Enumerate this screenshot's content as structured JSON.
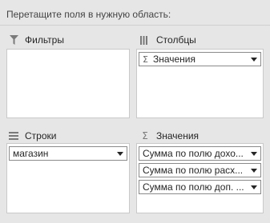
{
  "instruction": "Перетащите поля в нужную область:",
  "areas": {
    "filters": {
      "title": "Фильтры",
      "icon": "filter-icon",
      "fields": []
    },
    "columns": {
      "title": "Столбцы",
      "icon": "columns-icon",
      "fields": [
        {
          "label": "Значения",
          "icon": "sigma-icon"
        }
      ]
    },
    "rows": {
      "title": "Строки",
      "icon": "rows-icon",
      "fields": [
        {
          "label": "магазин"
        }
      ]
    },
    "values": {
      "title": "Значения",
      "icon": "sigma-icon",
      "fields": [
        {
          "label": "Сумма по полю дохо..."
        },
        {
          "label": "Сумма по полю расх..."
        },
        {
          "label": "Сумма по полю доп. ..."
        }
      ]
    }
  },
  "glyphs": {
    "sigma": "Σ"
  }
}
